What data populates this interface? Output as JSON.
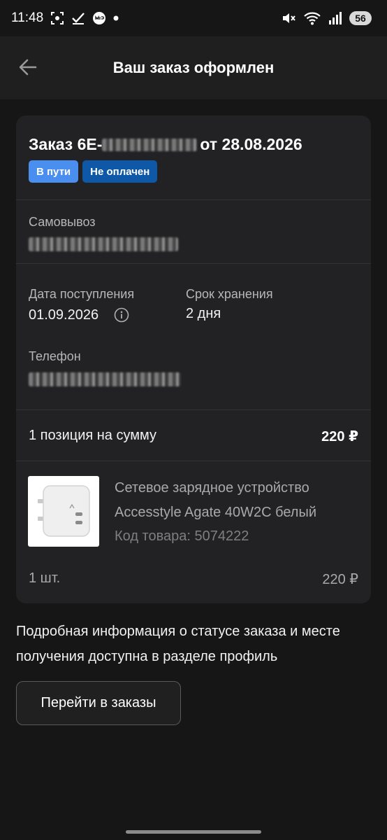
{
  "status_bar": {
    "time": "11:48",
    "battery": "56",
    "left_icons": [
      "screenshot-icon",
      "check-icon",
      "mir-pay-icon",
      "dot-icon"
    ],
    "right_icons": [
      "mute-icon",
      "wifi-icon",
      "signal-icon"
    ]
  },
  "header": {
    "title": "Ваш заказ оформлен",
    "back_icon": "arrow-left-icon"
  },
  "order": {
    "title_prefix": "Заказ 6E-",
    "title_date": "от 28.08.2026",
    "badges": [
      {
        "label": "В пути",
        "color": "#4a8ff0"
      },
      {
        "label": "Не оплачен",
        "color": "#0f58a8"
      }
    ],
    "pickup_label": "Самовывоз",
    "arrival_label": "Дата поступления",
    "arrival_value": "01.09.2026",
    "storage_label": "Срок хранения",
    "storage_value": "2 дня",
    "phone_label": "Телефон",
    "sum_label": "1 позиция на сумму",
    "sum_value": "220 ₽"
  },
  "product": {
    "name": "Сетевое зарядное устройство Accesstyle Agate 40W2C белый",
    "code_label": "Код товара:",
    "code_value": "5074222",
    "quantity": "1 шт.",
    "price": "220 ₽"
  },
  "info_text": "Подробная информация о статусе заказа и месте получения доступна в разделе профиль",
  "orders_button": "Перейти в заказы",
  "colors": {
    "background": "#161616",
    "card": "#222224",
    "accent": "#4a8ff0"
  }
}
